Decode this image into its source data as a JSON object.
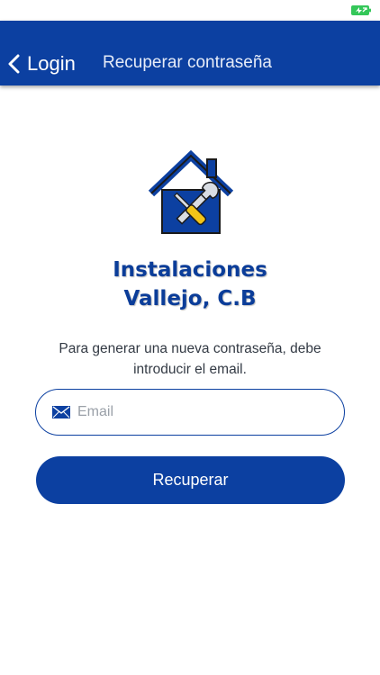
{
  "status_bar": {
    "battery_icon": "battery-charging-icon",
    "battery_color": "#34c759"
  },
  "nav": {
    "back_label": "Login",
    "back_icon": "chevron-left-icon",
    "title": "Recuperar contraseña",
    "background": "#0c40a1"
  },
  "logo": {
    "icon": "house-tools-logo"
  },
  "company": {
    "line1": "Instalaciones",
    "line2": "Vallejo, C.B"
  },
  "instructions": {
    "line1": "Para generar una nueva contraseña, debe",
    "line2": "introducir el email."
  },
  "email": {
    "placeholder": "Email",
    "value": "",
    "icon": "mail-icon"
  },
  "recover_button": {
    "label": "Recuperar"
  },
  "colors": {
    "primary": "#0c40a1",
    "accent": "#f2c418"
  }
}
